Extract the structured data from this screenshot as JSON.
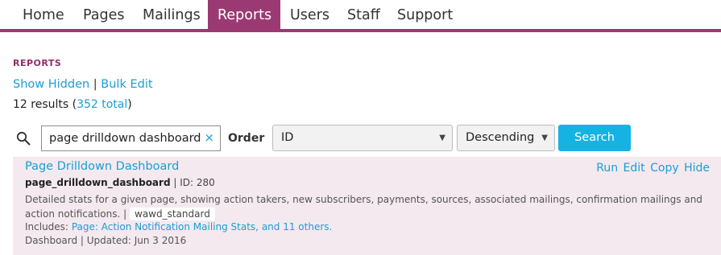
{
  "nav": {
    "home": "Home",
    "pages": "Pages",
    "mailings": "Mailings",
    "reports": "Reports",
    "users": "Users",
    "staff": "Staff",
    "support": "Support",
    "active_color": "#9b3a72"
  },
  "section": {
    "title": "REPORTS",
    "show_hidden": "Show Hidden",
    "separator": "|",
    "bulk_edit": "Bulk Edit",
    "results_prefix": "12 results (",
    "total_link": "352 total",
    "results_suffix": ")"
  },
  "search": {
    "icon": "search-icon",
    "value": "page drilldown dashboard",
    "clear": "×",
    "order_label": "Order",
    "order_field": "ID",
    "order_direction": "Descending",
    "button": "Search",
    "button_color": "#14b3e2"
  },
  "results": [
    {
      "title": "Page Drilldown Dashboard",
      "actions": [
        "Run",
        "Edit",
        "Copy",
        "Hide"
      ],
      "short_name": "page_drilldown_dashboard",
      "id_text": "| ID: 280",
      "description": "Detailed stats for a given page, showing action takers, new subscribers, payments, sources, associated mailings, confirmation mailings and action notifications. |",
      "tag": "wawd_standard",
      "includes_label": "Includes:",
      "includes_link": "Page: Action Notification Mailing Stats,",
      "includes_more": "and 11 others.",
      "footer": "Dashboard | Updated: Jun 3 2016"
    }
  ]
}
